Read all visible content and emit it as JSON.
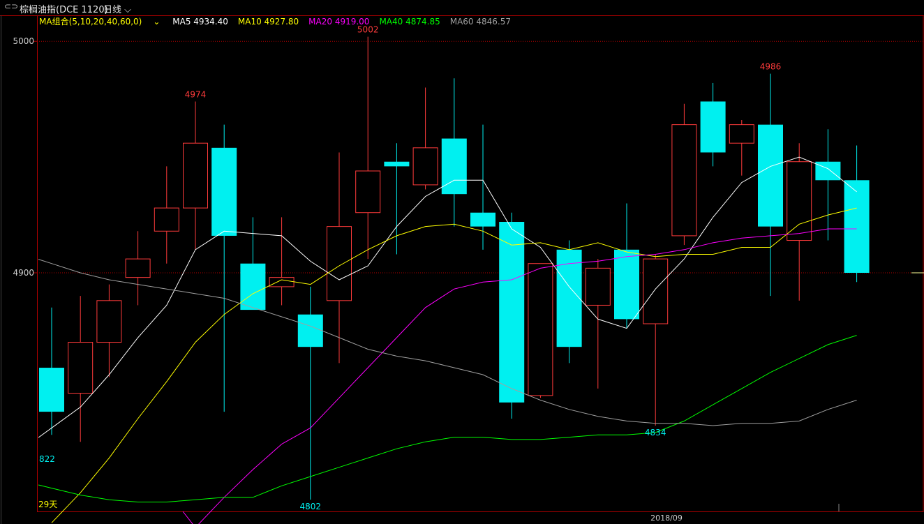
{
  "header": {
    "title": "棕榈油指(DCE 1120)",
    "period": "日线",
    "ma_group": "MA组合(5,10,20,40,60,0)",
    "ma_values": [
      {
        "label": "MA5 4934.40",
        "color": "#ffffff"
      },
      {
        "label": "MA10 4927.80",
        "color": "#ffff00"
      },
      {
        "label": "MA20 4919.00",
        "color": "#ff00ff"
      },
      {
        "label": "MA40 4874.85",
        "color": "#00ff00"
      },
      {
        "label": "MA60 4846.57",
        "color": "#a0a0a0"
      }
    ]
  },
  "chart_data": {
    "type": "candlestick",
    "y_ticks": [
      5000,
      4900
    ],
    "x_label": "2018/09",
    "ylim": [
      4798,
      5020
    ],
    "colors": {
      "up": "#ff3b3b",
      "down": "#00f0f0",
      "grid": "#b00000"
    },
    "candles": [
      {
        "o": 4859,
        "h": 4885,
        "l": 4830,
        "c": 4840
      },
      {
        "o": 4848,
        "h": 4890,
        "l": 4827,
        "c": 4870
      },
      {
        "o": 4870,
        "h": 4895,
        "l": 4855,
        "c": 4888
      },
      {
        "o": 4898,
        "h": 4918,
        "l": 4886,
        "c": 4906
      },
      {
        "o": 4918,
        "h": 4946,
        "l": 4904,
        "c": 4928
      },
      {
        "o": 4928,
        "h": 4974,
        "l": 4910,
        "c": 4956
      },
      {
        "o": 4954,
        "h": 4964,
        "l": 4840,
        "c": 4916
      },
      {
        "o": 4904,
        "h": 4924,
        "l": 4885,
        "c": 4884
      },
      {
        "o": 4894,
        "h": 4924,
        "l": 4886,
        "c": 4898
      },
      {
        "o": 4882,
        "h": 4894,
        "l": 4802,
        "c": 4868
      },
      {
        "o": 4888,
        "h": 4952,
        "l": 4861,
        "c": 4920
      },
      {
        "o": 4926,
        "h": 5002,
        "l": 4906,
        "c": 4944
      },
      {
        "o": 4948,
        "h": 4956,
        "l": 4908,
        "c": 4946
      },
      {
        "o": 4938,
        "h": 4980,
        "l": 4936,
        "c": 4954
      },
      {
        "o": 4958,
        "h": 4984,
        "l": 4920,
        "c": 4934
      },
      {
        "o": 4926,
        "h": 4964,
        "l": 4910,
        "c": 4920
      },
      {
        "o": 4922,
        "h": 4926,
        "l": 4837,
        "c": 4844
      },
      {
        "o": 4847,
        "h": 4904,
        "l": 4846,
        "c": 4904
      },
      {
        "o": 4910,
        "h": 4914,
        "l": 4861,
        "c": 4868
      },
      {
        "o": 4886,
        "h": 4906,
        "l": 4850,
        "c": 4902
      },
      {
        "o": 4910,
        "h": 4930,
        "l": 4876,
        "c": 4880
      },
      {
        "o": 4878,
        "h": 4908,
        "l": 4834,
        "c": 4906
      },
      {
        "o": 4916,
        "h": 4973,
        "l": 4912,
        "c": 4964
      },
      {
        "o": 4974,
        "h": 4982,
        "l": 4946,
        "c": 4952
      },
      {
        "o": 4956,
        "h": 4966,
        "l": 4942,
        "c": 4964
      },
      {
        "o": 4964,
        "h": 4986,
        "l": 4890,
        "c": 4920
      },
      {
        "o": 4914,
        "h": 4956,
        "l": 4888,
        "c": 4948
      },
      {
        "o": 4948,
        "h": 4962,
        "l": 4914,
        "c": 4940
      },
      {
        "o": 4940,
        "h": 4955,
        "l": 4896,
        "c": 4900
      }
    ],
    "ma": [
      {
        "name": "MA5",
        "color": "#ffffff",
        "values": [
          4833,
          4842,
          4856,
          4872,
          4886,
          4910,
          4918,
          4917,
          4916,
          4905,
          4897,
          4903,
          4920,
          4933,
          4940,
          4940,
          4919,
          4911,
          4894,
          4880,
          4876,
          4893,
          4906,
          4924,
          4939,
          4946,
          4950,
          4945,
          4935
        ]
      },
      {
        "name": "MA10",
        "color": "#ffff00",
        "values": [
          4792,
          4805,
          4820,
          4837,
          4853,
          4870,
          4882,
          4891,
          4897,
          4895,
          4903,
          4910,
          4916,
          4920,
          4921,
          4918,
          4912,
          4913,
          4910,
          4913,
          4909,
          4907,
          4908,
          4908,
          4911,
          4911,
          4921,
          4925,
          4928
        ]
      },
      {
        "name": "MA20",
        "color": "#ff00ff",
        "values": [
          null,
          null,
          null,
          null,
          null,
          4790,
          4803,
          4815,
          4826,
          4833,
          4846,
          4859,
          4872,
          4885,
          4893,
          4896,
          4897,
          4902,
          4904,
          4905,
          4907,
          4908,
          4910,
          4913,
          4915,
          4916,
          4917,
          4919,
          4919
        ]
      },
      {
        "name": "MA40",
        "color": "#00ff00",
        "values": [
          4807,
          4804,
          4802,
          4801,
          4801,
          4802,
          4803,
          4803,
          4808,
          4812,
          4816,
          4820,
          4824,
          4827,
          4829,
          4829,
          4828,
          4828,
          4829,
          4830,
          4830,
          4831,
          4836,
          4843,
          4850,
          4857,
          4863,
          4869,
          4873
        ]
      },
      {
        "name": "MA60",
        "color": "#a0a0a0",
        "values": [
          4904,
          4900,
          4897,
          4895,
          4893,
          4891,
          4889,
          4885,
          4881,
          4877,
          4872,
          4867,
          4864,
          4862,
          4859,
          4856,
          4850,
          4845,
          4841,
          4838,
          4836,
          4835,
          4835,
          4834,
          4835,
          4835,
          4836,
          4841,
          4845
        ]
      }
    ],
    "annotations": [
      {
        "text": "4974",
        "candle": 5,
        "value": 4974,
        "pos": "above",
        "color": "#ff3b3b"
      },
      {
        "text": "5002",
        "candle": 11,
        "value": 5002,
        "pos": "above",
        "color": "#ff3b3b"
      },
      {
        "text": "4986",
        "candle": 25,
        "value": 4986,
        "pos": "above",
        "color": "#ff3b3b"
      },
      {
        "text": "4834",
        "candle": 21,
        "value": 4834,
        "pos": "below",
        "color": "#00f0f0"
      },
      {
        "text": "4802",
        "candle": 9,
        "value": 4802,
        "pos": "below",
        "color": "#00f0f0"
      }
    ],
    "corner_labels": {
      "bottom_left": "29天",
      "left_low": "822"
    }
  }
}
